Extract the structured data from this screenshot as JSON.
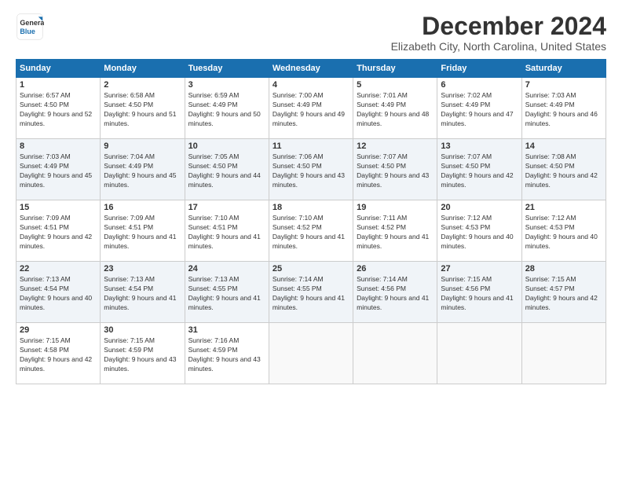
{
  "logo": {
    "general": "General",
    "blue": "Blue"
  },
  "title": "December 2024",
  "subtitle": "Elizabeth City, North Carolina, United States",
  "days_header": [
    "Sunday",
    "Monday",
    "Tuesday",
    "Wednesday",
    "Thursday",
    "Friday",
    "Saturday"
  ],
  "weeks": [
    [
      {
        "day": "1",
        "sunrise": "6:57 AM",
        "sunset": "4:50 PM",
        "daylight": "9 hours and 52 minutes."
      },
      {
        "day": "2",
        "sunrise": "6:58 AM",
        "sunset": "4:50 PM",
        "daylight": "9 hours and 51 minutes."
      },
      {
        "day": "3",
        "sunrise": "6:59 AM",
        "sunset": "4:49 PM",
        "daylight": "9 hours and 50 minutes."
      },
      {
        "day": "4",
        "sunrise": "7:00 AM",
        "sunset": "4:49 PM",
        "daylight": "9 hours and 49 minutes."
      },
      {
        "day": "5",
        "sunrise": "7:01 AM",
        "sunset": "4:49 PM",
        "daylight": "9 hours and 48 minutes."
      },
      {
        "day": "6",
        "sunrise": "7:02 AM",
        "sunset": "4:49 PM",
        "daylight": "9 hours and 47 minutes."
      },
      {
        "day": "7",
        "sunrise": "7:03 AM",
        "sunset": "4:49 PM",
        "daylight": "9 hours and 46 minutes."
      }
    ],
    [
      {
        "day": "8",
        "sunrise": "7:03 AM",
        "sunset": "4:49 PM",
        "daylight": "9 hours and 45 minutes."
      },
      {
        "day": "9",
        "sunrise": "7:04 AM",
        "sunset": "4:49 PM",
        "daylight": "9 hours and 45 minutes."
      },
      {
        "day": "10",
        "sunrise": "7:05 AM",
        "sunset": "4:50 PM",
        "daylight": "9 hours and 44 minutes."
      },
      {
        "day": "11",
        "sunrise": "7:06 AM",
        "sunset": "4:50 PM",
        "daylight": "9 hours and 43 minutes."
      },
      {
        "day": "12",
        "sunrise": "7:07 AM",
        "sunset": "4:50 PM",
        "daylight": "9 hours and 43 minutes."
      },
      {
        "day": "13",
        "sunrise": "7:07 AM",
        "sunset": "4:50 PM",
        "daylight": "9 hours and 42 minutes."
      },
      {
        "day": "14",
        "sunrise": "7:08 AM",
        "sunset": "4:50 PM",
        "daylight": "9 hours and 42 minutes."
      }
    ],
    [
      {
        "day": "15",
        "sunrise": "7:09 AM",
        "sunset": "4:51 PM",
        "daylight": "9 hours and 42 minutes."
      },
      {
        "day": "16",
        "sunrise": "7:09 AM",
        "sunset": "4:51 PM",
        "daylight": "9 hours and 41 minutes."
      },
      {
        "day": "17",
        "sunrise": "7:10 AM",
        "sunset": "4:51 PM",
        "daylight": "9 hours and 41 minutes."
      },
      {
        "day": "18",
        "sunrise": "7:10 AM",
        "sunset": "4:52 PM",
        "daylight": "9 hours and 41 minutes."
      },
      {
        "day": "19",
        "sunrise": "7:11 AM",
        "sunset": "4:52 PM",
        "daylight": "9 hours and 41 minutes."
      },
      {
        "day": "20",
        "sunrise": "7:12 AM",
        "sunset": "4:53 PM",
        "daylight": "9 hours and 40 minutes."
      },
      {
        "day": "21",
        "sunrise": "7:12 AM",
        "sunset": "4:53 PM",
        "daylight": "9 hours and 40 minutes."
      }
    ],
    [
      {
        "day": "22",
        "sunrise": "7:13 AM",
        "sunset": "4:54 PM",
        "daylight": "9 hours and 40 minutes."
      },
      {
        "day": "23",
        "sunrise": "7:13 AM",
        "sunset": "4:54 PM",
        "daylight": "9 hours and 41 minutes."
      },
      {
        "day": "24",
        "sunrise": "7:13 AM",
        "sunset": "4:55 PM",
        "daylight": "9 hours and 41 minutes."
      },
      {
        "day": "25",
        "sunrise": "7:14 AM",
        "sunset": "4:55 PM",
        "daylight": "9 hours and 41 minutes."
      },
      {
        "day": "26",
        "sunrise": "7:14 AM",
        "sunset": "4:56 PM",
        "daylight": "9 hours and 41 minutes."
      },
      {
        "day": "27",
        "sunrise": "7:15 AM",
        "sunset": "4:56 PM",
        "daylight": "9 hours and 41 minutes."
      },
      {
        "day": "28",
        "sunrise": "7:15 AM",
        "sunset": "4:57 PM",
        "daylight": "9 hours and 42 minutes."
      }
    ],
    [
      {
        "day": "29",
        "sunrise": "7:15 AM",
        "sunset": "4:58 PM",
        "daylight": "9 hours and 42 minutes."
      },
      {
        "day": "30",
        "sunrise": "7:15 AM",
        "sunset": "4:59 PM",
        "daylight": "9 hours and 43 minutes."
      },
      {
        "day": "31",
        "sunrise": "7:16 AM",
        "sunset": "4:59 PM",
        "daylight": "9 hours and 43 minutes."
      },
      null,
      null,
      null,
      null
    ]
  ]
}
